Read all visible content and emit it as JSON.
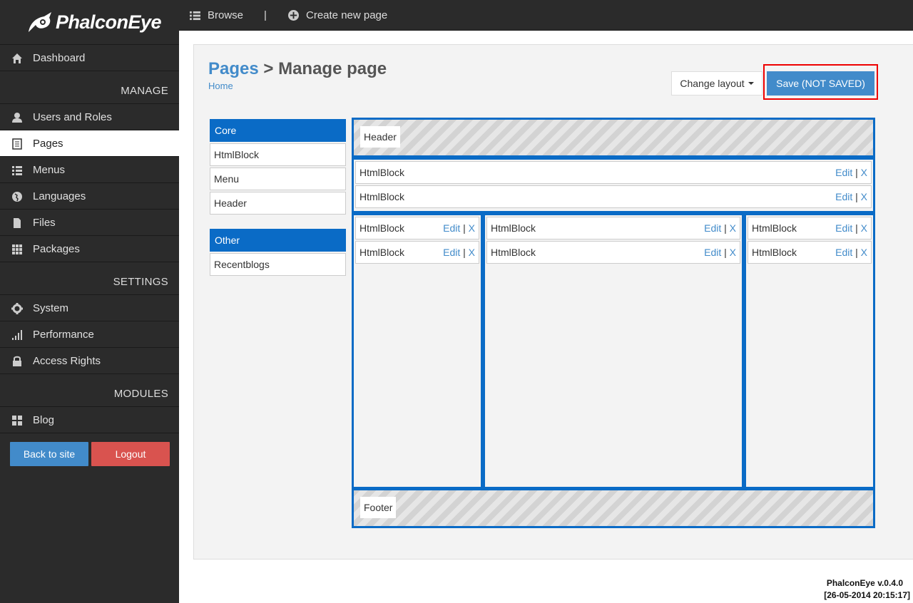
{
  "brand": {
    "name": "PhalconEye"
  },
  "sidebar": {
    "items": [
      {
        "label": "Dashboard",
        "icon": "home-icon"
      },
      {
        "label": "Users and Roles",
        "icon": "user-icon"
      },
      {
        "label": "Pages",
        "icon": "pages-icon",
        "active": true
      },
      {
        "label": "Menus",
        "icon": "list-icon"
      },
      {
        "label": "Languages",
        "icon": "globe-icon"
      },
      {
        "label": "Files",
        "icon": "file-icon"
      },
      {
        "label": "Packages",
        "icon": "grid-icon"
      },
      {
        "label": "System",
        "icon": "gear-icon"
      },
      {
        "label": "Performance",
        "icon": "signal-icon"
      },
      {
        "label": "Access Rights",
        "icon": "lock-icon"
      },
      {
        "label": "Blog",
        "icon": "blocks-icon"
      }
    ],
    "sections": {
      "manage": "MANAGE",
      "settings": "SETTINGS",
      "modules": "MODULES"
    },
    "back_label": "Back to site",
    "logout_label": "Logout"
  },
  "topbar": {
    "browse": "Browse",
    "separator": "|",
    "create": "Create new page"
  },
  "page": {
    "crumb": "Pages",
    "title": "> Manage page",
    "home": "Home",
    "change_layout": "Change layout",
    "save": "Save (NOT SAVED)"
  },
  "widgets": {
    "core_head": "Core",
    "core_items": [
      "HtmlBlock",
      "Menu",
      "Header"
    ],
    "other_head": "Other",
    "other_items": [
      "Recentblogs"
    ]
  },
  "layout": {
    "header_label": "Header",
    "footer_label": "Footer",
    "block_name": "HtmlBlock",
    "edit": "Edit",
    "sep": "|",
    "remove": "X"
  },
  "footer": {
    "version": "PhalconEye v.0.4.0",
    "date": "[26-05-2014 20:15:17]"
  },
  "colors": {
    "accent": "#428bca",
    "zone": "#0a6bc6",
    "danger": "#d9534f",
    "sidebar": "#2b2b2b"
  }
}
